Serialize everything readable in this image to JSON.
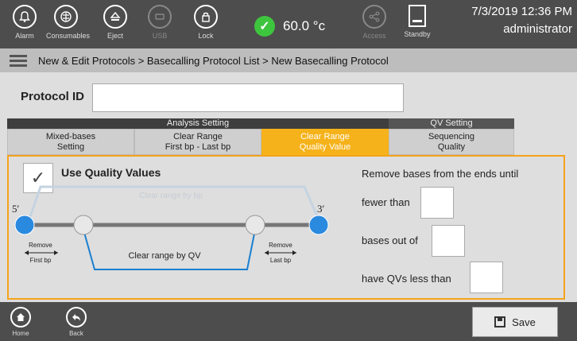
{
  "topbar": {
    "buttons": [
      {
        "label": "Alarm",
        "icon": "bell-icon"
      },
      {
        "label": "Consumables",
        "icon": "consumables-icon"
      },
      {
        "label": "Eject",
        "icon": "eject-icon"
      },
      {
        "label": "USB",
        "icon": "usb-icon",
        "disabled": true
      },
      {
        "label": "Lock",
        "icon": "lock-icon"
      }
    ],
    "temperature": "60.0 °c",
    "access_label": "Access",
    "standby_label": "Standby",
    "datetime": "7/3/2019 12:36 PM",
    "user": "administrator"
  },
  "breadcrumb": "New & Edit Protocols > Basecalling Protocol List > New Basecalling Protocol",
  "protocol_id": {
    "label": "Protocol ID",
    "value": ""
  },
  "groups": {
    "analysis": "Analysis Setting",
    "qv": "QV Setting"
  },
  "tabs": [
    {
      "label": "Mixed-bases\nSetting"
    },
    {
      "label": "Clear Range\nFirst bp - Last bp"
    },
    {
      "label": "Clear Range\nQuality Value"
    },
    {
      "label": "Sequencing\nQuality"
    }
  ],
  "panel": {
    "use_qv_label": "Use Quality Values",
    "use_qv_checked": true,
    "diagram": {
      "five_prime": "5′",
      "three_prime": "3′",
      "clear_by_bp": "Clear range by bp",
      "clear_by_qv": "Clear range by QV",
      "remove_first": "Remove",
      "first_bp": "First bp",
      "remove_last": "Remove",
      "last_bp": "Last bp"
    },
    "remove_text": "Remove bases from the ends until",
    "fewer_than": "fewer than",
    "bases_out_of": "bases out of",
    "have_qvs": "have QVs less than",
    "fewer_than_value": "",
    "bases_out_of_value": "",
    "have_qvs_value": ""
  },
  "bottombar": {
    "home": "Home",
    "back": "Back",
    "save": "Save"
  },
  "colors": {
    "accent": "#f5b21a",
    "blue": "#1a7fcf",
    "dark": "#4d4d4d"
  }
}
